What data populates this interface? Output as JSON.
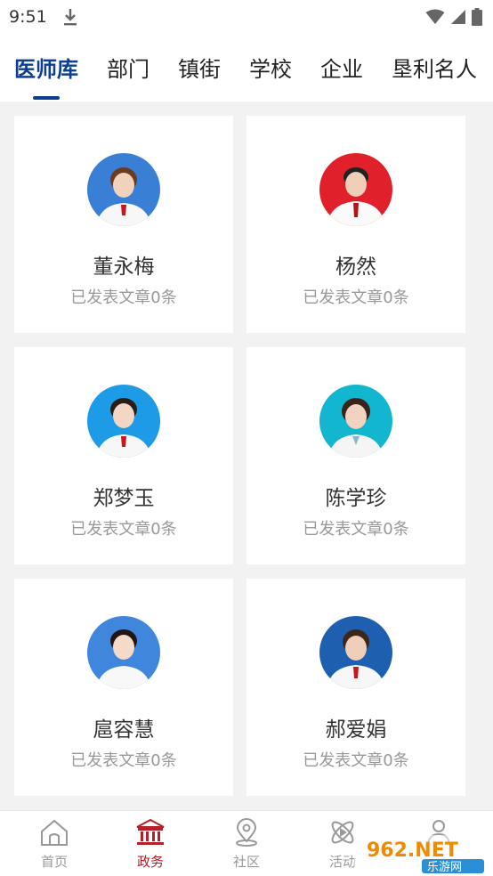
{
  "status_bar": {
    "time": "9:51"
  },
  "tabs": [
    {
      "label": "医师库",
      "active": true
    },
    {
      "label": "部门"
    },
    {
      "label": "镇街"
    },
    {
      "label": "学校"
    },
    {
      "label": "企业"
    },
    {
      "label": "垦利名人"
    }
  ],
  "doctors": [
    {
      "name": "董永梅",
      "articles": "已发表文章0条"
    },
    {
      "name": "杨然",
      "articles": "已发表文章0条"
    },
    {
      "name": "郑梦玉",
      "articles": "已发表文章0条"
    },
    {
      "name": "陈学珍",
      "articles": "已发表文章0条"
    },
    {
      "name": "扈容慧",
      "articles": "已发表文章0条"
    },
    {
      "name": "郝爱娟",
      "articles": "已发表文章0条"
    }
  ],
  "bottom_nav": [
    {
      "label": "首页",
      "icon": "home-icon"
    },
    {
      "label": "政务",
      "icon": "government-icon",
      "active": true
    },
    {
      "label": "社区",
      "icon": "location-pin-icon"
    },
    {
      "label": "活动",
      "icon": "activity-icon"
    },
    {
      "label": "",
      "icon": "profile-icon"
    }
  ],
  "watermark": {
    "text_top": "962.NET",
    "text_bottom": "乐游网"
  },
  "colors": {
    "accent": "#0d3e8f",
    "active_nav": "#b4202a",
    "background": "#f2f2f2"
  }
}
